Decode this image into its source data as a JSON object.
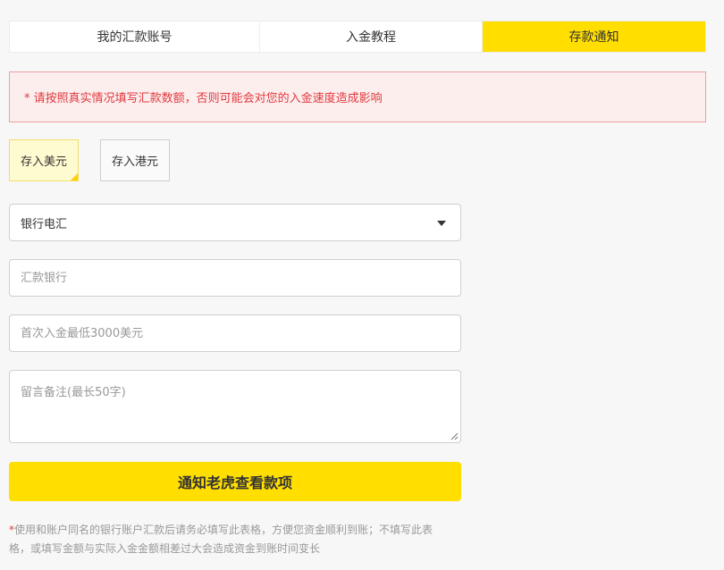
{
  "tabs": [
    {
      "label": "我的汇款账号",
      "active": false
    },
    {
      "label": "入金教程",
      "active": false
    },
    {
      "label": "存款通知",
      "active": true
    }
  ],
  "warning": {
    "text": "* 请按照真实情况填写汇款数额，否则可能会对您的入金速度造成影响",
    "color": "#e0393e"
  },
  "currency": {
    "usd_label": "存入美元",
    "hkd_label": "存入港元",
    "selected": "存入美元"
  },
  "form": {
    "method_value": "银行电汇",
    "bank_placeholder": "汇款银行",
    "amount_placeholder": "首次入金最低3000美元",
    "note_placeholder": "留言备注(最长50字)"
  },
  "submit_label": "通知老虎查看款项",
  "footnote": {
    "star": "*",
    "text": "使用和账户同名的银行账户汇款后请务必填写此表格，方便您资金顺利到账；不填写此表格，或填写金额与实际入金金额相差过大会造成资金到账时间变长"
  },
  "colors": {
    "accent": "#ffde00",
    "warning_bg": "#fdeeee",
    "warning_border": "#eaa0a0"
  }
}
